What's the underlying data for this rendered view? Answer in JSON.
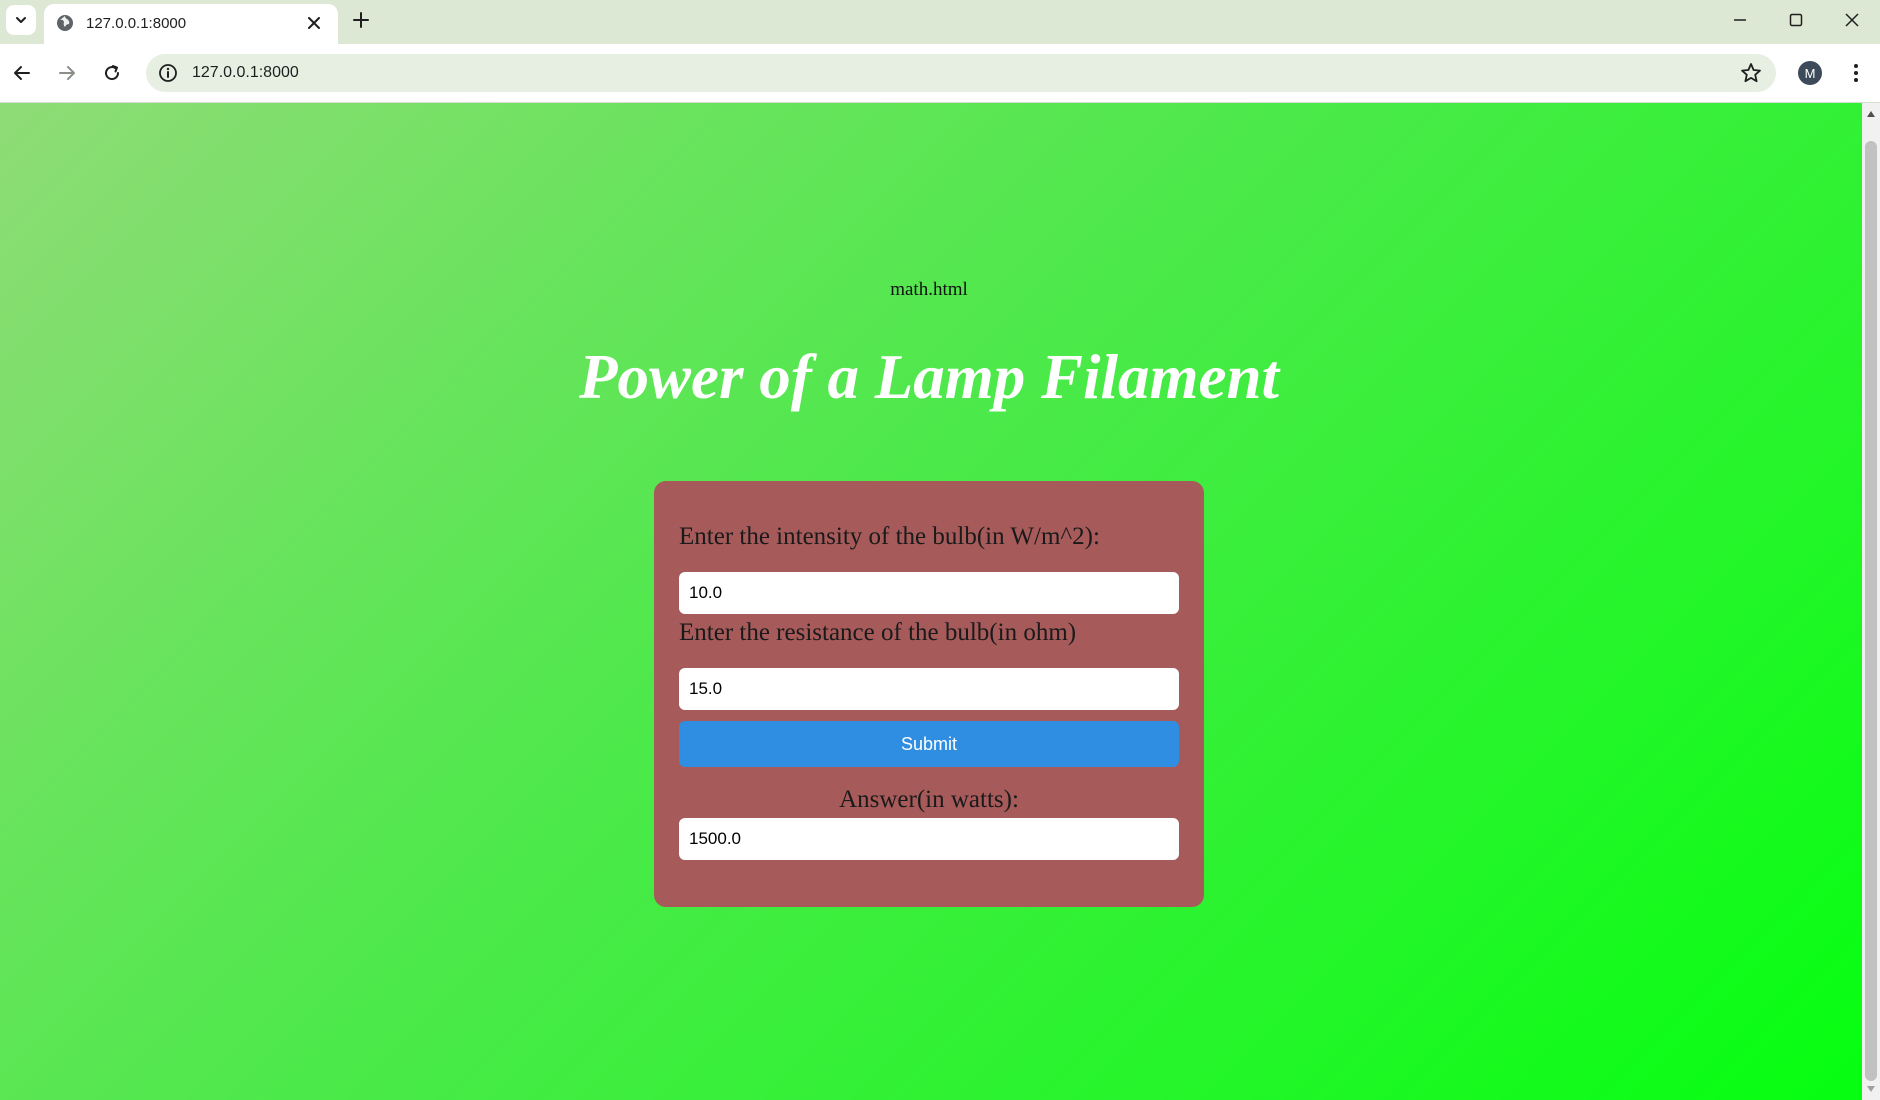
{
  "browser": {
    "tab_title": "127.0.0.1:8000",
    "url": "127.0.0.1:8000",
    "avatar_initial": "M"
  },
  "page": {
    "filename": "math.html",
    "title": "Power of a Lamp Filament",
    "form": {
      "intensity_label": "Enter the intensity of the bulb(in W/m^2):",
      "intensity_value": "10.0",
      "resistance_label": "Enter the resistance of the bulb(in ohm)",
      "resistance_value": "15.0",
      "submit_label": "Submit",
      "answer_label": "Answer(in watts):",
      "answer_value": "1500.0"
    }
  },
  "colors": {
    "card": "#a65a5a",
    "submit": "#2f8ee2",
    "title": "#ffffff",
    "background_start": "#8fdc76",
    "background_end": "#05ff10"
  }
}
